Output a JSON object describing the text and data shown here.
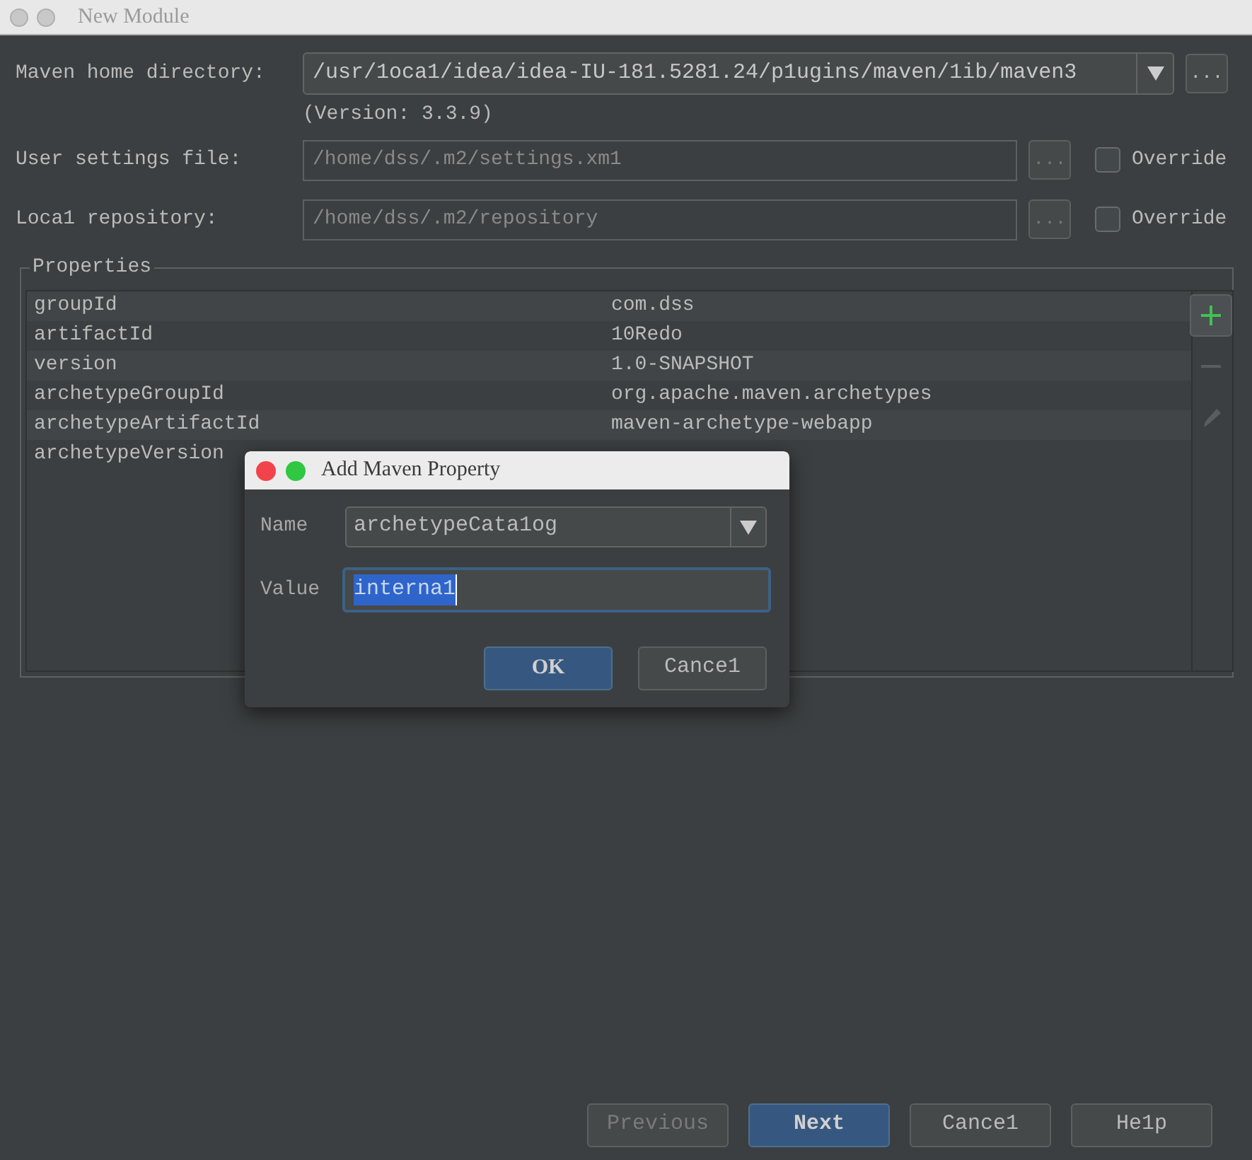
{
  "window": {
    "title": "New Module"
  },
  "maven_home": {
    "label": "Maven home directory:",
    "value": "/usr/1oca1/idea/idea-IU-181.5281.24/p1ugins/maven/1ib/maven3",
    "version": "(Version: 3.3.9)",
    "browse_label": "..."
  },
  "settings_rows": [
    {
      "label": "User settings file:",
      "value": "/home/dss/.m2/settings.xm1",
      "browse_label": "...",
      "override": {
        "label": "Override",
        "checked": false
      }
    },
    {
      "label": "Loca1 repository:",
      "value": "/home/dss/.m2/repository",
      "browse_label": "...",
      "override": {
        "label": "Override",
        "checked": false
      }
    }
  ],
  "properties": {
    "title": "Properties",
    "rows": [
      {
        "name": "groupId",
        "value": "com.dss"
      },
      {
        "name": "artifactId",
        "value": "10Redo"
      },
      {
        "name": "version",
        "value": "1.0-SNAPSHOT"
      },
      {
        "name": "archetypeGroupId",
        "value": "org.apache.maven.archetypes"
      },
      {
        "name": "archetypeArtifactId",
        "value": "maven-archetype-webapp"
      },
      {
        "name": "archetypeVersion"
      }
    ],
    "tools": [
      {
        "kind": "add",
        "disabled": false
      },
      {
        "kind": "remove",
        "disabled": true
      },
      {
        "kind": "edit",
        "disabled": true
      }
    ]
  },
  "dialog": {
    "title": "Add Maven Property",
    "name_label": "Name",
    "name_value": "archetypeCata1og",
    "value_label": "Value",
    "value": "interna1",
    "buttons": [
      {
        "label": "OK",
        "default": true
      },
      {
        "label": "Cance1",
        "default": false
      }
    ]
  },
  "buttons": [
    {
      "label": "Previous",
      "disabled": true,
      "default": false
    },
    {
      "label": "Next",
      "disabled": false,
      "default": true
    },
    {
      "label": "Cance1",
      "disabled": false,
      "default": false
    },
    {
      "label": "He1p",
      "disabled": false,
      "default": false
    }
  ]
}
